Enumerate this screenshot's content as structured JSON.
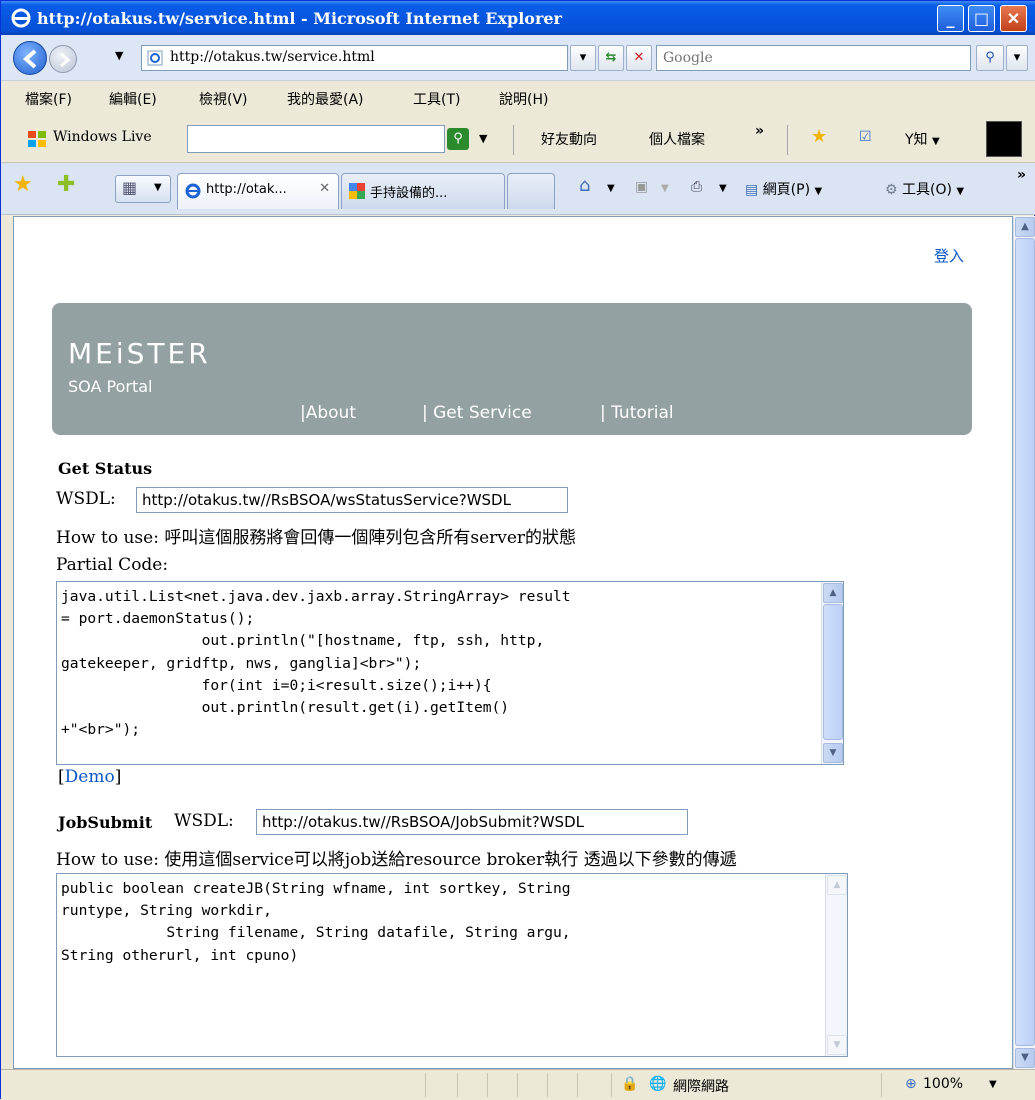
{
  "window": {
    "title": "http://otakus.tw/service.html - Microsoft Internet Explorer"
  },
  "toolbar": {
    "url": "http://otakus.tw/service.html",
    "search_placeholder": "Google"
  },
  "menu": {
    "items": [
      "檔案(F)",
      "編輯(E)",
      "檢視(V)",
      "我的最愛(A)",
      "工具(T)",
      "說明(H)"
    ]
  },
  "links_bar": {
    "brand": "Windows Live",
    "friends": "好友動向",
    "profile": "個人檔案",
    "more": "»",
    "knowledge": "Y知"
  },
  "tabs": [
    {
      "label": "http://otak..."
    },
    {
      "label": "手持設備的..."
    }
  ],
  "command_bar": {
    "page": "網頁(P)",
    "tools": "工具(O)",
    "more": "»"
  },
  "page": {
    "login": "登入",
    "banner": {
      "logo": "MEiSTER",
      "subtitle": "SOA Portal",
      "nav": [
        "|About",
        "| Get Service",
        "| Tutorial"
      ]
    },
    "get_status": {
      "heading": "Get Status",
      "wsdl_label": "WSDL:",
      "wsdl_value": "http://otakus.tw//RsBSOA/wsStatusService?WSDL",
      "how_to_use": "How to use: 呼叫這個服務將會回傳一個陣列包含所有server的狀態",
      "partial_code_label": "Partial Code:",
      "code": "java.util.List<net.java.dev.jaxb.array.StringArray> result\n= port.daemonStatus();\n                out.println(\"[hostname, ftp, ssh, http,\ngatekeeper, gridftp, nws, ganglia]<br>\");\n                for(int i=0;i<result.size();i++){\n                out.println(result.get(i).getItem()\n+\"<br>\");",
      "demo_bracket_open": "[",
      "demo_link": "Demo",
      "demo_bracket_close": "]"
    },
    "job_submit": {
      "heading": "JobSubmit",
      "wsdl_label": "WSDL:",
      "wsdl_value": "http://otakus.tw//RsBSOA/JobSubmit?WSDL",
      "how_to_use": "How to use: 使用這個service可以將job送給resource broker執行 透過以下參數的傳遞",
      "code": "public boolean createJB(String wfname, int sortkey, String\nruntype, String workdir,\n            String filename, String datafile, String argu,\nString otherurl, int cpuno)"
    }
  },
  "status_bar": {
    "zone": "網際網路",
    "zoom": "100%"
  }
}
